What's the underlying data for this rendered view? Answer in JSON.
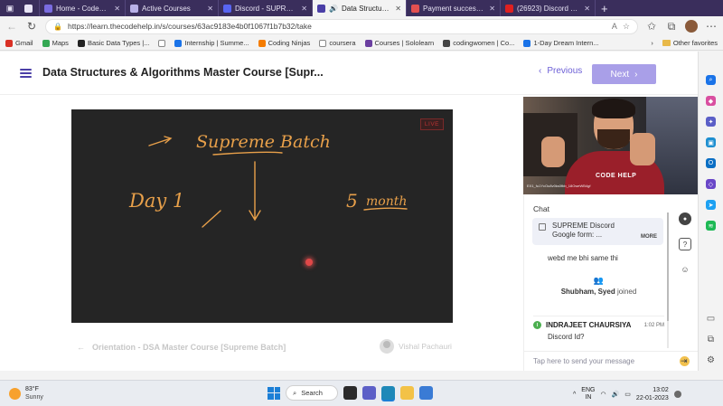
{
  "browser": {
    "tabs": [
      {
        "label": "",
        "color": "#e8e4f5",
        "active": false
      },
      {
        "label": "Home - CodeHelp",
        "color": "#7a6ce0",
        "active": false
      },
      {
        "label": "Active Courses",
        "color": "#b8b0e8",
        "active": false
      },
      {
        "label": "Discord - SUPREME B",
        "color": "#5865f2",
        "active": false
      },
      {
        "label": "Data Structures",
        "color": "#4b3fa7",
        "active": true
      },
      {
        "label": "Payment successful fo",
        "color": "#e35050",
        "active": false
      },
      {
        "label": "(26923) Discord | Pro",
        "color": "#e02020",
        "active": false
      }
    ],
    "url": "https://learn.thecodehelp.in/s/courses/63ac9183e4b0f1067f1b7b32/take",
    "bookmarks": [
      {
        "label": "Gmail",
        "color": "#d93025"
      },
      {
        "label": "Maps",
        "color": "#34a853"
      },
      {
        "label": "Basic Data Types |...",
        "color": "#222222"
      },
      {
        "label": "",
        "color": "#cccccc"
      },
      {
        "label": "Internship | Summe...",
        "color": "#1a73e8"
      },
      {
        "label": "Coding Ninjas",
        "color": "#f57c00"
      },
      {
        "label": "coursera",
        "color": "#999999"
      },
      {
        "label": "Courses | Sololearn",
        "color": "#6b3fa0"
      },
      {
        "label": "codingwomen | Co...",
        "color": "#444444"
      },
      {
        "label": "1-Day Dream Intern...",
        "color": "#1a73e8"
      }
    ],
    "other_favorites": "Other favorites"
  },
  "course": {
    "title": "Data Structures & Algorithms Master Course [Supr...",
    "previous_label": "Previous",
    "next_label": "Next"
  },
  "video": {
    "live_badge": "LIVE",
    "board_text": {
      "line1": "Supreme Batch",
      "left": "Day 1",
      "right_num": "5",
      "right_word": "month"
    }
  },
  "lesson": {
    "prev_lesson": "Orientation - DSA Master Course [Supreme Batch]",
    "instructor": "Vishal Pachauri"
  },
  "webcam": {
    "overlay_logo": "CODE HELP",
    "label": "EX1_fu1YcOu8v0ks0fbb_18OweWB4gf"
  },
  "chat": {
    "title": "Chat",
    "pinned": {
      "line1": "SUPREME Discord",
      "line2": "Google form: ...",
      "more": "MORE"
    },
    "message1": "webd me bhi same thi",
    "join_names": "Shubham, Syed",
    "join_suffix": " joined",
    "message2": {
      "initial": "I",
      "author": "INDRAJEET CHAURSIYA",
      "time": "1:02 PM",
      "text": "Discord Id?"
    },
    "input_placeholder": "Tap here to send your message"
  },
  "taskbar": {
    "temp": "83°F",
    "condition": "Sunny",
    "search_label": "Search",
    "lang1": "ENG",
    "lang2": "IN",
    "time": "13:02",
    "date": "22-01-2023"
  }
}
